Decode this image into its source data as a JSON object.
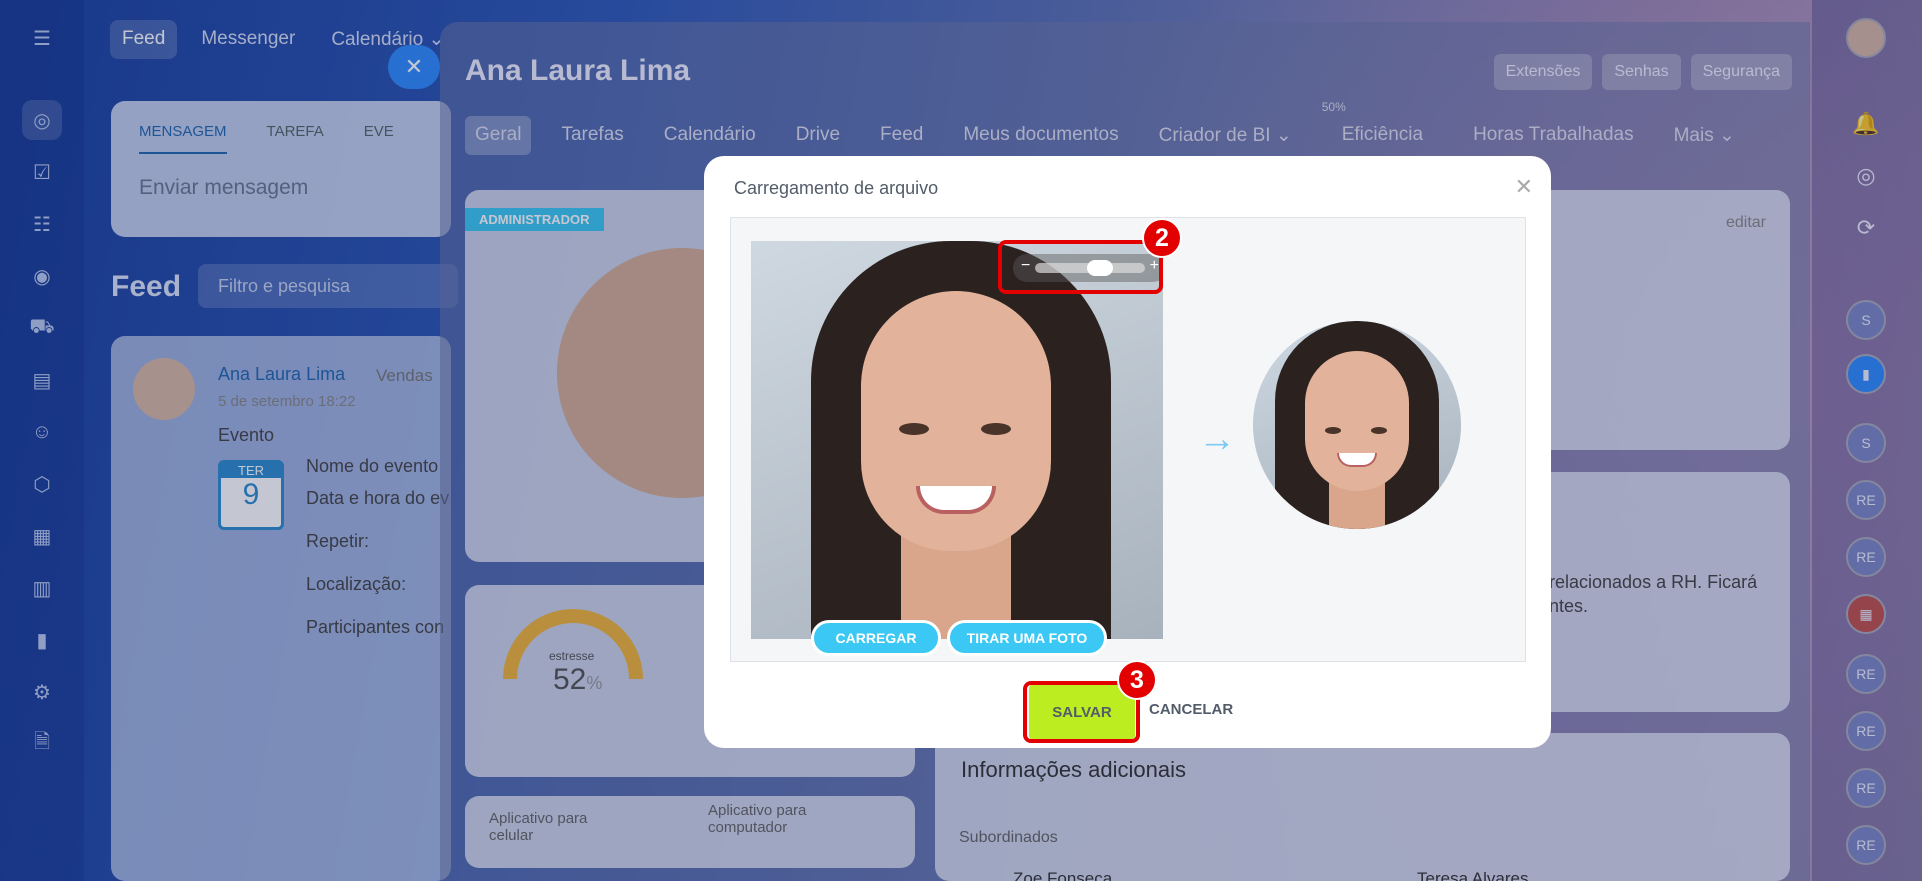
{
  "topnav": {
    "feed": "Feed",
    "messenger": "Messenger",
    "calendar": "Calendário ⌄"
  },
  "feedbox": {
    "tab_message": "MENSAGEM",
    "tab_task": "TAREFA",
    "tab_event": "EVE",
    "send_placeholder": "Enviar mensagem"
  },
  "feed": {
    "title": "Feed",
    "filter": "Filtro e pesquisa"
  },
  "post": {
    "author": "Ana Laura Lima",
    "target": "Vendas",
    "date": "5 de setembro 18:22",
    "type": "Evento",
    "cal_day": "TER",
    "cal_num": "9",
    "f1": "Nome do evento",
    "f2": "Data e hora do ev",
    "f3": "Repetir:",
    "f4": "Localização:",
    "f5": "Participantes con"
  },
  "panel": {
    "title": "Ana Laura Lima",
    "btn_ext": "Extensões",
    "btn_pass": "Senhas",
    "btn_sec": "Segurança",
    "tabs": [
      "Geral",
      "Tarefas",
      "Calendário",
      "Drive",
      "Feed",
      "Meus documentos",
      "Criador de BI ⌄",
      "Eficiência",
      "Horas Trabalhadas",
      "Mais ⌄"
    ],
    "eff_pct": "50%",
    "admin": "ADMINISTRADOR",
    "edit": "editar",
    "stress_label": "estresse",
    "stress_value": "52",
    "stress_unit": "%",
    "rh_text": "relacionados a RH. Ficará",
    "rh_text2": "ntes.",
    "extra_title": "Informações adicionais",
    "subordinates": "Subordinados",
    "sub1": "Zoe Fonseca",
    "sub2": "Teresa Alvares",
    "app_mobile": "Aplicativo para celular",
    "app_desktop": "Aplicativo para computador"
  },
  "rightbar": {
    "av1": "S",
    "av2": "S",
    "av3": "RE",
    "av4": "RE",
    "av5": "RE",
    "av6": "RE",
    "av7": "RE",
    "av8": "RE"
  },
  "modal": {
    "title": "Carregamento de arquivo",
    "upload": "CARREGAR",
    "photo": "TIRAR UMA FOTO",
    "save": "SALVAR",
    "cancel": "CANCELAR"
  },
  "badges": {
    "b2": "2",
    "b3": "3"
  },
  "colors": {
    "save": "#bbed21",
    "accent": "#3bc8f5",
    "highlight": "#e30000"
  }
}
